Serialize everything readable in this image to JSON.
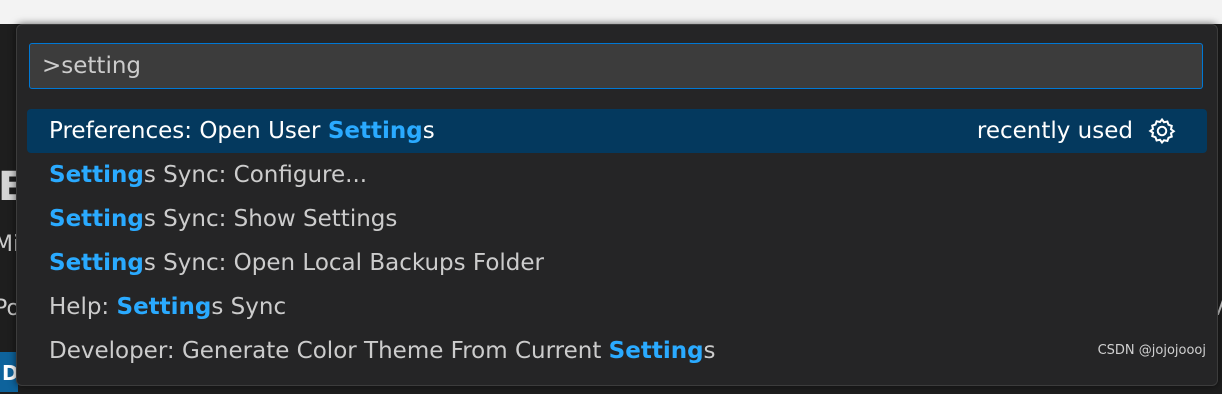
{
  "command_palette": {
    "input_value": ">setting",
    "items": [
      {
        "prefix": "Preferences: Open User ",
        "match": "Setting",
        "suffix": "s",
        "badge": "recently used",
        "icon": "gear-icon"
      },
      {
        "prefix": "",
        "match": "Setting",
        "suffix": "s Sync: Configure..."
      },
      {
        "prefix": "",
        "match": "Setting",
        "suffix": "s Sync: Show Settings"
      },
      {
        "prefix": "",
        "match": "Setting",
        "suffix": "s Sync: Open Local Backups Folder"
      },
      {
        "prefix": "Help: ",
        "match": "Setting",
        "suffix": "s Sync"
      },
      {
        "prefix": "Developer: Generate Color Theme From Current ",
        "match": "Setting",
        "suffix": "s"
      }
    ]
  },
  "background_fragments": {
    "f1": "E",
    "f2": "Mi",
    "f3": "Po",
    "f4": "V",
    "f5": "D"
  },
  "watermark": "CSDN @jojojoooj",
  "colors": {
    "highlight": "#2aaaff",
    "active_row": "#04395e",
    "input_border": "#0078d4"
  }
}
